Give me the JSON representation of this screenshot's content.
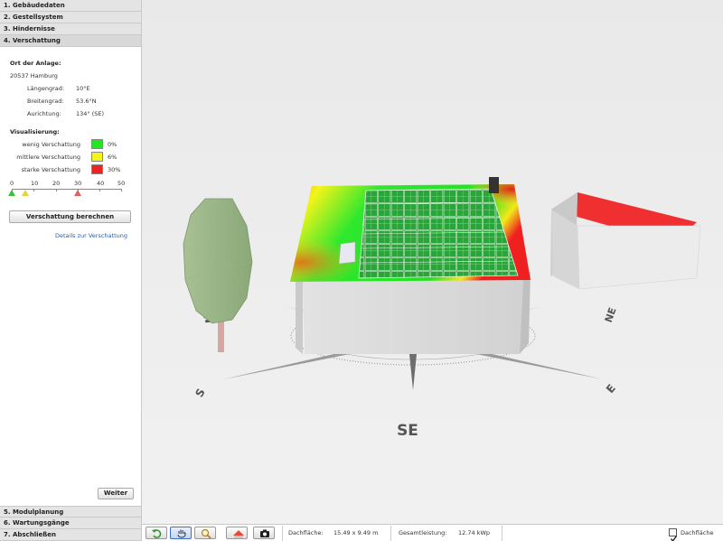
{
  "steps_top": [
    {
      "label": "1. Gebäudedaten"
    },
    {
      "label": "2. Gestellsystem"
    },
    {
      "label": "3. Hindernisse"
    },
    {
      "label": "4. Verschattung"
    }
  ],
  "steps_bottom": [
    {
      "label": "5. Modulplanung"
    },
    {
      "label": "6. Wartungsgänge"
    },
    {
      "label": "7. Abschließen"
    }
  ],
  "location": {
    "heading": "Ort der Anlage:",
    "place": "20537 Hamburg",
    "rows": [
      {
        "label": "Längengrad:",
        "value": "10°E"
      },
      {
        "label": "Breitengrad:",
        "value": "53.6°N"
      },
      {
        "label": "Aurichtung:",
        "value": "134° (SE)"
      }
    ]
  },
  "visualization": {
    "heading": "Visualisierung:",
    "legend": [
      {
        "label": "wenig Verschattung",
        "value": "0%",
        "color": "#1ee81e"
      },
      {
        "label": "mittlere Verschattung",
        "value": "6%",
        "color": "#f4f41a"
      },
      {
        "label": "starke Verschattung",
        "value": "30%",
        "color": "#ee2222"
      }
    ],
    "scale_labels": [
      "0",
      "10",
      "20",
      "30",
      "40",
      "50"
    ],
    "markers": [
      {
        "value": 0,
        "color": "#3cbf3c"
      },
      {
        "value": 6,
        "color": "#e6d23a"
      },
      {
        "value": 30,
        "color": "#e06060"
      }
    ]
  },
  "buttons": {
    "calculate": "Verschattung berechnen",
    "details": "Details zur Verschattung",
    "next": "Weiter"
  },
  "compass": {
    "labels": [
      {
        "text": "SE"
      },
      {
        "text": "S"
      },
      {
        "text": "E"
      },
      {
        "text": "NE"
      },
      {
        "text": "SW"
      }
    ]
  },
  "toolbar": {
    "roof_label": "Dachfläche:",
    "roof_value": "15.49 x 9.49 m",
    "power_label": "Gesamtleistung:",
    "power_value": "12.74 kWp",
    "checkbox_label": "Dachfläche",
    "checkbox_checked": true
  },
  "colors": {
    "roof_low": "#1ee81e",
    "roof_mid": "#f4f41a",
    "roof_high": "#ee2222",
    "neighbor_roof": "#f03030"
  }
}
